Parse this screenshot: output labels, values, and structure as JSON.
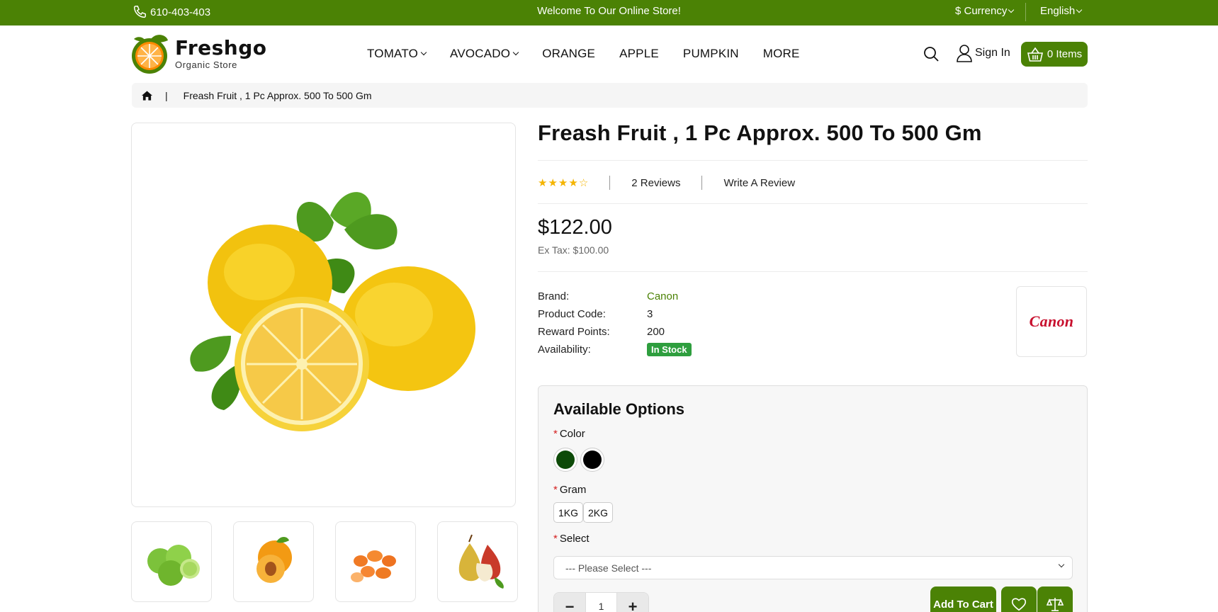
{
  "topbar": {
    "phone": "610-403-403",
    "welcome": "Welcome To Our Online Store!",
    "currency": "$ Currency",
    "language": "English"
  },
  "header": {
    "logo_name": "Freshgo",
    "logo_tagline": "Organic Store",
    "nav": [
      {
        "label": "TOMATO"
      },
      {
        "label": "AVOCADO"
      },
      {
        "label": "ORANGE"
      },
      {
        "label": "APPLE"
      },
      {
        "label": "PUMPKIN"
      },
      {
        "label": "MORE"
      }
    ],
    "signin": "Sign In",
    "cart": "0 Items"
  },
  "breadcrumb": {
    "divider": "|",
    "current": "Freash Fruit , 1 Pc Approx. 500 To 500 Gm"
  },
  "product": {
    "title": "Freash Fruit , 1 Pc Approx. 500 To 500 Gm",
    "rating": 4,
    "rating_max": 5,
    "reviews": "2 Reviews",
    "write_review": "Write A Review",
    "price": "$122.00",
    "ex_tax": "Ex Tax: $100.00",
    "specs": [
      {
        "key": "Brand:",
        "value": "Canon"
      },
      {
        "key": "Product Code:",
        "value": "3"
      },
      {
        "key": "Reward Points:",
        "value": "200"
      },
      {
        "key": "Availability:",
        "value": "In Stock"
      }
    ],
    "brand_logo_text": "Canon"
  },
  "options": {
    "title": "Available Options",
    "required_mark": "*",
    "color_label": "Color",
    "colors": [
      "#0d4a08",
      "#000000"
    ],
    "gram_label": "Gram",
    "grams": [
      "1KG",
      "2KG"
    ],
    "select_label": "Select",
    "select_placeholder": "--- Please Select ---",
    "quantity": "1",
    "minus": "−",
    "plus": "+",
    "add_to_cart": "Add To Cart"
  },
  "colors": {
    "brand_green": "#4b8205",
    "star": "#f4b400",
    "in_stock": "#2e9e3e",
    "required": "#d42020"
  }
}
